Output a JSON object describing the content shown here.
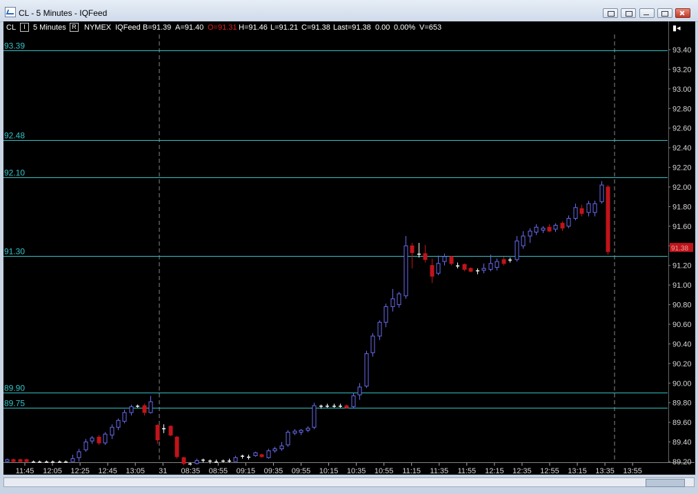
{
  "window": {
    "title": "CL - 5 Minutes - IQFeed"
  },
  "infobar": {
    "symbol": "CL",
    "interval": "5 Minutes",
    "interval_btn": "I",
    "range_btn": "R",
    "exchange": "NYMEX",
    "feed": "IQFeed",
    "bid": "B=91.39",
    "ask": "A=91.40",
    "open": "O=91.31",
    "high": "H=91.46",
    "low": "L=91.21",
    "close": "C=91.38",
    "last": "Last=91.38",
    "change": "0.00",
    "change_pct": "0.00%",
    "volume": "V=653",
    "panel_toggle": "▮◂"
  },
  "colors": {
    "up": "#6a6cf0",
    "down": "#c0141a",
    "doji": "#ffffff",
    "level": "#35c4c8",
    "axis_text": "#d8d8d8",
    "level_text": "#35c4c8",
    "last_badge": "#c0141a"
  },
  "chart_data": {
    "type": "candlestick",
    "ylim": [
      89.2,
      93.5
    ],
    "y_ticks": [
      "93.40",
      "93.20",
      "93.00",
      "92.80",
      "92.60",
      "92.40",
      "92.20",
      "92.00",
      "91.80",
      "91.60",
      "91.40",
      "91.20",
      "91.00",
      "90.80",
      "90.60",
      "90.40",
      "90.20",
      "90.00",
      "89.80",
      "89.60",
      "89.40",
      "89.20"
    ],
    "x_ticks": [
      "11:45",
      "12:05",
      "12:25",
      "12:45",
      "13:05",
      "31",
      "08:35",
      "08:55",
      "09:15",
      "09:35",
      "09:55",
      "10:15",
      "10:35",
      "10:55",
      "11:15",
      "11:35",
      "11:55",
      "12:15",
      "12:35",
      "12:55",
      "13:15",
      "13:35",
      "13:55"
    ],
    "levels": [
      {
        "value": 93.39,
        "label": "93.39"
      },
      {
        "value": 92.48,
        "label": "92.48"
      },
      {
        "value": 92.1,
        "label": "92.10"
      },
      {
        "value": 91.3,
        "label": "91.30"
      },
      {
        "value": 89.9,
        "label": "89.90"
      },
      {
        "value": 89.75,
        "label": "89.75"
      }
    ],
    "last_price": 91.38,
    "last_label": "91.38",
    "candles": [
      {
        "o": 89.2,
        "h": 89.23,
        "l": 89.19,
        "c": 89.22
      },
      {
        "o": 89.22,
        "h": 89.23,
        "l": 89.19,
        "c": 89.2
      },
      {
        "o": 89.22,
        "h": 89.23,
        "l": 89.19,
        "c": 89.2
      },
      {
        "o": 89.22,
        "h": 89.23,
        "l": 89.19,
        "c": 89.2
      },
      {
        "o": 89.2,
        "h": 89.21,
        "l": 89.2,
        "c": 89.2
      },
      {
        "o": 89.2,
        "h": 89.21,
        "l": 89.2,
        "c": 89.2
      },
      {
        "o": 89.2,
        "h": 89.21,
        "l": 89.2,
        "c": 89.2
      },
      {
        "o": 89.2,
        "h": 89.21,
        "l": 89.2,
        "c": 89.2
      },
      {
        "o": 89.2,
        "h": 89.21,
        "l": 89.2,
        "c": 89.2
      },
      {
        "o": 89.2,
        "h": 89.21,
        "l": 89.2,
        "c": 89.2
      },
      {
        "o": 89.2,
        "h": 89.27,
        "l": 89.2,
        "c": 89.23
      },
      {
        "o": 89.24,
        "h": 89.33,
        "l": 89.2,
        "c": 89.3
      },
      {
        "o": 89.32,
        "h": 89.43,
        "l": 89.3,
        "c": 89.4
      },
      {
        "o": 89.41,
        "h": 89.46,
        "l": 89.38,
        "c": 89.44
      },
      {
        "o": 89.45,
        "h": 89.47,
        "l": 89.37,
        "c": 89.39
      },
      {
        "o": 89.39,
        "h": 89.5,
        "l": 89.37,
        "c": 89.48
      },
      {
        "o": 89.47,
        "h": 89.58,
        "l": 89.43,
        "c": 89.55
      },
      {
        "o": 89.55,
        "h": 89.64,
        "l": 89.52,
        "c": 89.62
      },
      {
        "o": 89.61,
        "h": 89.73,
        "l": 89.59,
        "c": 89.7
      },
      {
        "o": 89.7,
        "h": 89.78,
        "l": 89.67,
        "c": 89.76
      },
      {
        "o": 89.77,
        "h": 89.78,
        "l": 89.75,
        "c": 89.76
      },
      {
        "o": 89.77,
        "h": 89.79,
        "l": 89.67,
        "c": 89.7
      },
      {
        "o": 89.7,
        "h": 89.87,
        "l": 89.69,
        "c": 89.81
      },
      {
        "o": 89.57,
        "h": 89.58,
        "l": 89.38,
        "c": 89.42
      },
      {
        "o": 89.54,
        "h": 89.58,
        "l": 89.49,
        "c": 89.54
      },
      {
        "o": 89.56,
        "h": 89.57,
        "l": 89.46,
        "c": 89.47
      },
      {
        "o": 89.45,
        "h": 89.46,
        "l": 89.23,
        "c": 89.25
      },
      {
        "o": 89.24,
        "h": 89.25,
        "l": 89.16,
        "c": 89.18
      },
      {
        "o": 89.18,
        "h": 89.19,
        "l": 89.18,
        "c": 89.18
      },
      {
        "o": 89.18,
        "h": 89.23,
        "l": 89.17,
        "c": 89.21
      },
      {
        "o": 89.22,
        "h": 89.23,
        "l": 89.19,
        "c": 89.21
      },
      {
        "o": 89.21,
        "h": 89.22,
        "l": 89.18,
        "c": 89.2
      },
      {
        "o": 89.2,
        "h": 89.22,
        "l": 89.19,
        "c": 89.2
      },
      {
        "o": 89.2,
        "h": 89.22,
        "l": 89.19,
        "c": 89.21
      },
      {
        "o": 89.21,
        "h": 89.23,
        "l": 89.19,
        "c": 89.2
      },
      {
        "o": 89.2,
        "h": 89.26,
        "l": 89.2,
        "c": 89.24
      },
      {
        "o": 89.26,
        "h": 89.27,
        "l": 89.23,
        "c": 89.25
      },
      {
        "o": 89.25,
        "h": 89.27,
        "l": 89.22,
        "c": 89.25
      },
      {
        "o": 89.26,
        "h": 89.3,
        "l": 89.25,
        "c": 89.29
      },
      {
        "o": 89.27,
        "h": 89.28,
        "l": 89.24,
        "c": 89.25
      },
      {
        "o": 89.24,
        "h": 89.33,
        "l": 89.23,
        "c": 89.31
      },
      {
        "o": 89.31,
        "h": 89.35,
        "l": 89.29,
        "c": 89.33
      },
      {
        "o": 89.33,
        "h": 89.4,
        "l": 89.31,
        "c": 89.36
      },
      {
        "o": 89.37,
        "h": 89.52,
        "l": 89.35,
        "c": 89.5
      },
      {
        "o": 89.49,
        "h": 89.53,
        "l": 89.47,
        "c": 89.51
      },
      {
        "o": 89.5,
        "h": 89.53,
        "l": 89.47,
        "c": 89.52
      },
      {
        "o": 89.52,
        "h": 89.56,
        "l": 89.5,
        "c": 89.54
      },
      {
        "o": 89.55,
        "h": 89.8,
        "l": 89.53,
        "c": 89.77
      },
      {
        "o": 89.77,
        "h": 89.78,
        "l": 89.74,
        "c": 89.76
      },
      {
        "o": 89.77,
        "h": 89.79,
        "l": 89.75,
        "c": 89.76
      },
      {
        "o": 89.77,
        "h": 89.79,
        "l": 89.75,
        "c": 89.76
      },
      {
        "o": 89.77,
        "h": 89.79,
        "l": 89.75,
        "c": 89.76
      },
      {
        "o": 89.77,
        "h": 89.78,
        "l": 89.74,
        "c": 89.75
      },
      {
        "o": 89.76,
        "h": 89.9,
        "l": 89.74,
        "c": 89.87
      },
      {
        "o": 89.88,
        "h": 90.0,
        "l": 89.83,
        "c": 89.96
      },
      {
        "o": 89.97,
        "h": 90.33,
        "l": 89.95,
        "c": 90.3
      },
      {
        "o": 90.31,
        "h": 90.51,
        "l": 90.27,
        "c": 90.48
      },
      {
        "o": 90.48,
        "h": 90.64,
        "l": 90.44,
        "c": 90.62
      },
      {
        "o": 90.62,
        "h": 90.81,
        "l": 90.57,
        "c": 90.78
      },
      {
        "o": 90.78,
        "h": 90.96,
        "l": 90.73,
        "c": 90.86
      },
      {
        "o": 90.8,
        "h": 90.93,
        "l": 90.77,
        "c": 90.91
      },
      {
        "o": 90.89,
        "h": 91.5,
        "l": 90.86,
        "c": 91.4
      },
      {
        "o": 91.4,
        "h": 91.43,
        "l": 91.17,
        "c": 91.33
      },
      {
        "o": 91.32,
        "h": 91.43,
        "l": 91.28,
        "c": 91.32
      },
      {
        "o": 91.32,
        "h": 91.41,
        "l": 91.23,
        "c": 91.26
      },
      {
        "o": 91.2,
        "h": 91.27,
        "l": 91.02,
        "c": 91.09
      },
      {
        "o": 91.12,
        "h": 91.3,
        "l": 91.1,
        "c": 91.22
      },
      {
        "o": 91.24,
        "h": 91.32,
        "l": 91.2,
        "c": 91.29
      },
      {
        "o": 91.29,
        "h": 91.3,
        "l": 91.2,
        "c": 91.22
      },
      {
        "o": 91.2,
        "h": 91.23,
        "l": 91.17,
        "c": 91.2
      },
      {
        "o": 91.21,
        "h": 91.22,
        "l": 91.14,
        "c": 91.16
      },
      {
        "o": 91.17,
        "h": 91.18,
        "l": 91.13,
        "c": 91.14
      },
      {
        "o": 91.15,
        "h": 91.17,
        "l": 91.11,
        "c": 91.15
      },
      {
        "o": 91.15,
        "h": 91.22,
        "l": 91.12,
        "c": 91.17
      },
      {
        "o": 91.16,
        "h": 91.31,
        "l": 91.14,
        "c": 91.22
      },
      {
        "o": 91.18,
        "h": 91.27,
        "l": 91.15,
        "c": 91.24
      },
      {
        "o": 91.26,
        "h": 91.29,
        "l": 91.2,
        "c": 91.22
      },
      {
        "o": 91.25,
        "h": 91.28,
        "l": 91.23,
        "c": 91.26
      },
      {
        "o": 91.26,
        "h": 91.5,
        "l": 91.24,
        "c": 91.45
      },
      {
        "o": 91.4,
        "h": 91.55,
        "l": 91.37,
        "c": 91.5
      },
      {
        "o": 91.5,
        "h": 91.58,
        "l": 91.43,
        "c": 91.55
      },
      {
        "o": 91.54,
        "h": 91.62,
        "l": 91.51,
        "c": 91.59
      },
      {
        "o": 91.56,
        "h": 91.6,
        "l": 91.53,
        "c": 91.58
      },
      {
        "o": 91.59,
        "h": 91.62,
        "l": 91.54,
        "c": 91.55
      },
      {
        "o": 91.57,
        "h": 91.63,
        "l": 91.54,
        "c": 91.61
      },
      {
        "o": 91.63,
        "h": 91.65,
        "l": 91.55,
        "c": 91.58
      },
      {
        "o": 91.6,
        "h": 91.71,
        "l": 91.58,
        "c": 91.68
      },
      {
        "o": 91.68,
        "h": 91.83,
        "l": 91.66,
        "c": 91.79
      },
      {
        "o": 91.78,
        "h": 91.82,
        "l": 91.7,
        "c": 91.73
      },
      {
        "o": 91.74,
        "h": 91.86,
        "l": 91.7,
        "c": 91.83
      },
      {
        "o": 91.74,
        "h": 91.86,
        "l": 91.7,
        "c": 91.83
      },
      {
        "o": 91.85,
        "h": 92.06,
        "l": 91.83,
        "c": 92.02
      },
      {
        "o": 92.0,
        "h": 92.02,
        "l": 91.31,
        "c": 91.34
      }
    ]
  }
}
